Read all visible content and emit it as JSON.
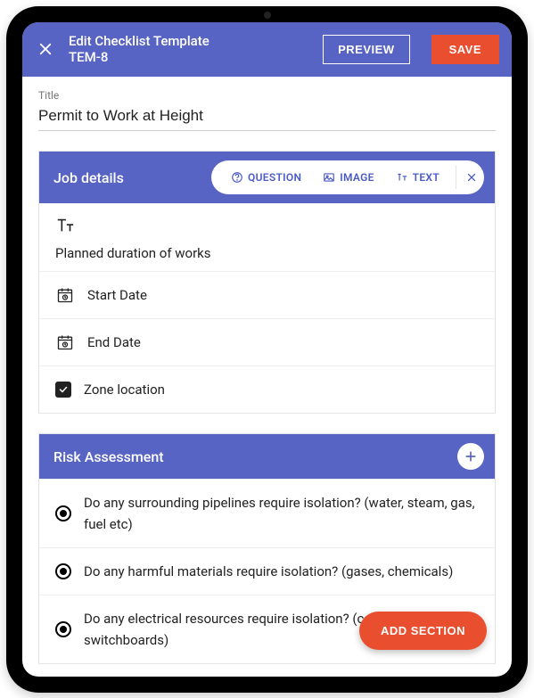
{
  "header": {
    "title_line1": "Edit Checklist Template",
    "title_line2": "TEM-8",
    "preview_label": "PREVIEW",
    "save_label": "SAVE"
  },
  "title_field": {
    "label": "Title",
    "value": "Permit to Work at Height"
  },
  "sections": [
    {
      "title": "Job details",
      "expanded": true,
      "toolbar": {
        "question_label": "QUESTION",
        "image_label": "IMAGE",
        "text_label": "TEXT"
      },
      "items": [
        {
          "type": "text",
          "label": "Planned duration of works"
        },
        {
          "type": "date",
          "label": "Start Date"
        },
        {
          "type": "date",
          "label": "End Date"
        },
        {
          "type": "checkbox",
          "label": "Zone location"
        }
      ]
    },
    {
      "title": "Risk Assessment",
      "expanded": false,
      "items": [
        {
          "type": "radio",
          "label": "Do any surrounding pipelines require isolation? (water, steam, gas, fuel etc)"
        },
        {
          "type": "radio",
          "label": "Do any harmful materials require isolation? (gases, chemicals)"
        },
        {
          "type": "radio",
          "label": "Do any electrical resources require isolation? (cables, switchboards)"
        }
      ]
    }
  ],
  "fab_label": "ADD SECTION",
  "colors": {
    "primary": "#5864c3",
    "accent": "#e94e2f"
  }
}
